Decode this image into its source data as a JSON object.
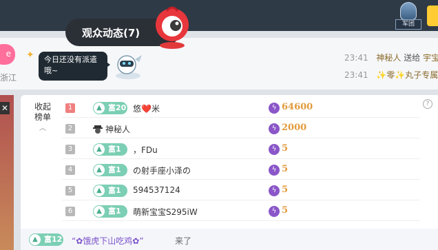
{
  "header": {
    "tab_label": "观众动态(7)",
    "mascot_icon": "mascot-icon",
    "corner_button_label": "军团",
    "corner_button_icon": "helmet-icon"
  },
  "strip": {
    "left_button_label": "e",
    "city": "浙江",
    "tooltip": "今日还没有派遣哦~",
    "activities": [
      {
        "time": "23:41",
        "name": "神秘人",
        "verb": "送给",
        "target": "宇宝"
      },
      {
        "time": "23:41",
        "name": "✨零✨丸子专属",
        "verb": "",
        "target": ""
      }
    ]
  },
  "panel": {
    "collapse_label": "收起榜单",
    "collapse_icon": "chevron-up-icon",
    "help_icon": "question-icon",
    "rows": [
      {
        "rank": "1",
        "badge": "富20",
        "name": "悠❤️米",
        "score": "64600"
      },
      {
        "rank": "2",
        "badge": "",
        "name": "神秘人",
        "score": "2000"
      },
      {
        "rank": "3",
        "badge": "富1",
        "name": "，FDu",
        "score": "5"
      },
      {
        "rank": "4",
        "badge": "富1",
        "name": "の射手座小泽の",
        "score": "5"
      },
      {
        "rank": "5",
        "badge": "富1",
        "name": "594537124",
        "score": "5"
      },
      {
        "rank": "6",
        "badge": "富1",
        "name": "萌新宝宝S295iW",
        "score": "5"
      }
    ]
  },
  "footer": {
    "badge": "富12",
    "user": "“✿饿虎下山吃鸡✿”",
    "action": "来了"
  },
  "colors": {
    "topbar": "#2f3a47",
    "badge_green": "#7ccfb4",
    "score_orange": "#e29a3b",
    "bolt_purple": "#8a56c8",
    "rank1_red": "#f08080"
  }
}
